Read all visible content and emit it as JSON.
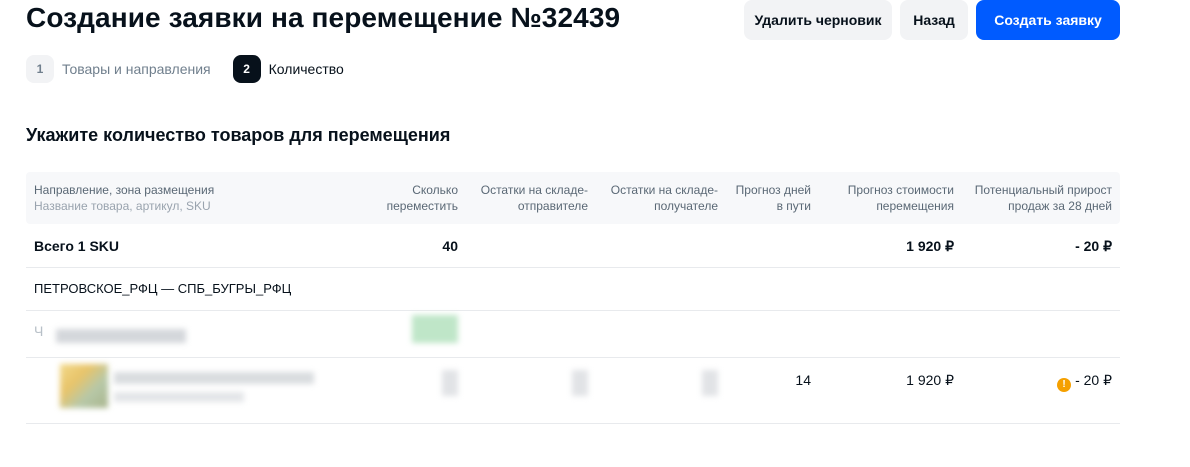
{
  "header": {
    "title": "Создание заявки на перемещение №32439",
    "delete_draft_label": "Удалить черновик",
    "back_label": "Назад",
    "create_label": "Создать заявку"
  },
  "steps": [
    {
      "number": "1",
      "label": "Товары и направления",
      "active": false
    },
    {
      "number": "2",
      "label": "Количество",
      "active": true
    }
  ],
  "section_title": "Укажите количество товаров для перемещения",
  "table": {
    "headers": {
      "direction": "Направление, зона размещения",
      "direction_sub": "Название товара, артикул, SKU",
      "move_qty_1": "Сколько",
      "move_qty_2": "переместить",
      "stock_sender_1": "Остатки на складе-",
      "stock_sender_2": "отправителе",
      "stock_receiver_1": "Остатки на складе-",
      "stock_receiver_2": "получателе",
      "days_1": "Прогноз дней",
      "days_2": "в пути",
      "cost_1": "Прогноз стоимости",
      "cost_2": "перемещения",
      "growth_1": "Потенциальный прирост",
      "growth_2": "продаж за 28 дней"
    },
    "total": {
      "label": "Всего 1 SKU",
      "qty": "40",
      "cost": "1 920 ₽",
      "growth": "- 20 ₽"
    },
    "route": "ПЕТРОВСКОЕ_РФЦ — СПБ_БУГРЫ_РФЦ",
    "zone_prefix": "Ч",
    "item": {
      "days": "14",
      "cost": "1 920 ₽",
      "growth": "- 20 ₽",
      "warning_icon": "warning-circle-icon"
    }
  },
  "colors": {
    "primary": "#005bff",
    "warning": "#f5a000",
    "text": "#07111b"
  }
}
